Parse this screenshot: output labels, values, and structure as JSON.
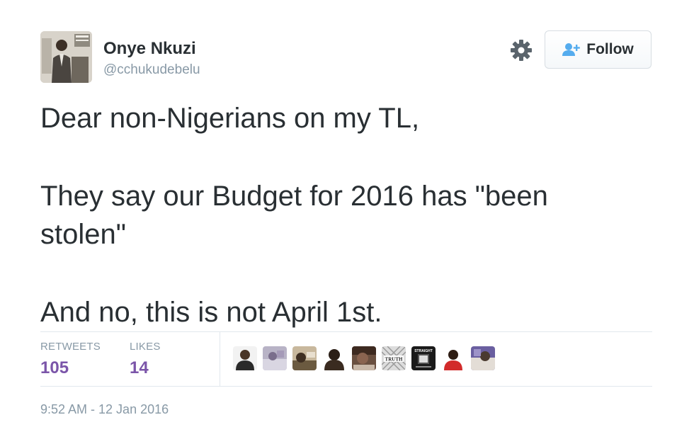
{
  "author": {
    "display_name": "Onye Nkuzi",
    "handle": "@cchukudebelu"
  },
  "actions": {
    "follow_label": "Follow",
    "settings_icon": "gear-icon",
    "follow_icon": "add-user-icon"
  },
  "tweet": {
    "lines": [
      "Dear non-Nigerians on my TL,",
      "They say our Budget for 2016 has \"been stolen\"",
      "And no, this is not April 1st."
    ]
  },
  "stats": {
    "retweets_label": "RETWEETS",
    "retweets_value": "105",
    "likes_label": "LIKES",
    "likes_value": "14"
  },
  "likers": {
    "truth_text": "TRUTH",
    "straight_text": "STRAIGHT"
  },
  "timestamp": "9:52 AM - 12 Jan 2016",
  "colors": {
    "stat_value": "#7b55a9",
    "muted": "#8899a6",
    "text": "#292f33",
    "border": "#e1e8ed"
  }
}
